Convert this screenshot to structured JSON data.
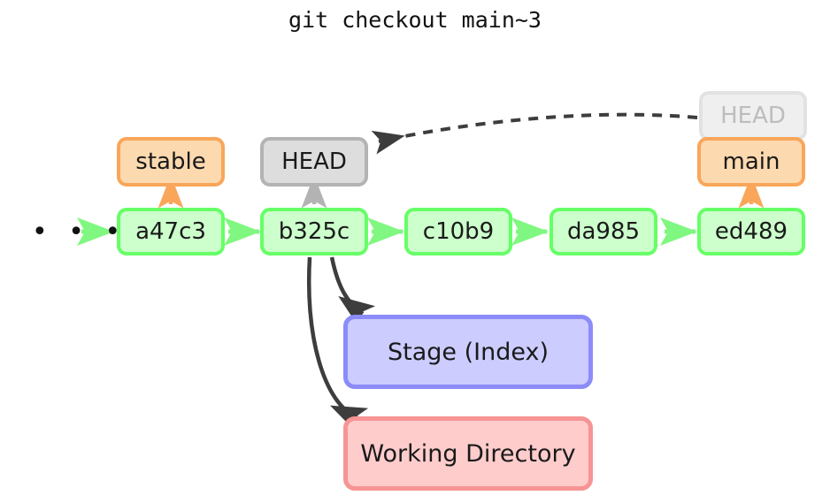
{
  "title": "git checkout main~3",
  "colors": {
    "commit_fill": "#ccffcc",
    "commit_border": "#66ff66",
    "ref_orange_fill": "#fcd9af",
    "ref_orange_border": "#f9a65a",
    "ref_gray_fill": "#dddddd",
    "ref_gray_border": "#b3b3b3",
    "ghost_fill": "#efefef",
    "ghost_border": "#e2e2e2",
    "ghost_text": "#bdbdbd",
    "stage_fill": "#ccccff",
    "stage_border": "#8c8cf9",
    "work_fill": "#ffcccc",
    "work_border": "#f79494",
    "arrow_dark": "#3d3d3d",
    "arrow_green": "#80f780",
    "arrow_orange": "#f9a65a",
    "arrow_gray": "#b3b3b3"
  },
  "ellipsis": "• • •",
  "commits": [
    {
      "id": "a47c3"
    },
    {
      "id": "b325c"
    },
    {
      "id": "c10b9"
    },
    {
      "id": "da985"
    },
    {
      "id": "ed489"
    }
  ],
  "refs": [
    {
      "label": "stable",
      "style": "orange",
      "points_to": "a47c3"
    },
    {
      "label": "HEAD",
      "style": "gray",
      "points_to": "b325c"
    },
    {
      "label": "HEAD",
      "style": "ghost",
      "points_to": "ed489"
    },
    {
      "label": "main",
      "style": "orange",
      "points_to": "ed489"
    }
  ],
  "areas": [
    {
      "label": "Stage (Index)",
      "style": "stage"
    },
    {
      "label": "Working Directory",
      "style": "work"
    }
  ]
}
